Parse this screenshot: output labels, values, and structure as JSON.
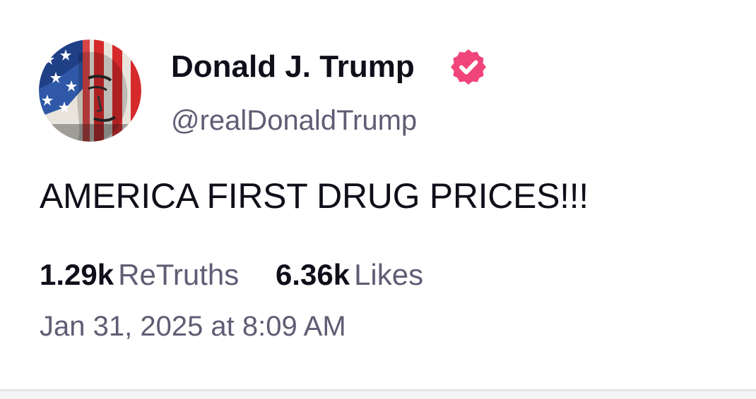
{
  "author": {
    "name": "Donald J. Trump",
    "handle": "@realDonaldTrump",
    "verified": true,
    "badge_icon": "verified-badge-icon",
    "badge_color": "#f0457a"
  },
  "post": {
    "text": "AMERICA FIRST DRUG PRICES!!!",
    "retruths_count": "1.29k",
    "retruths_label": "ReTruths",
    "likes_count": "6.36k",
    "likes_label": "Likes",
    "timestamp": "Jan 31, 2025 at 8:09 AM"
  },
  "colors": {
    "text_primary": "#0f0f1a",
    "text_secondary": "#5f5d73",
    "divider": "#e6e6ea"
  }
}
